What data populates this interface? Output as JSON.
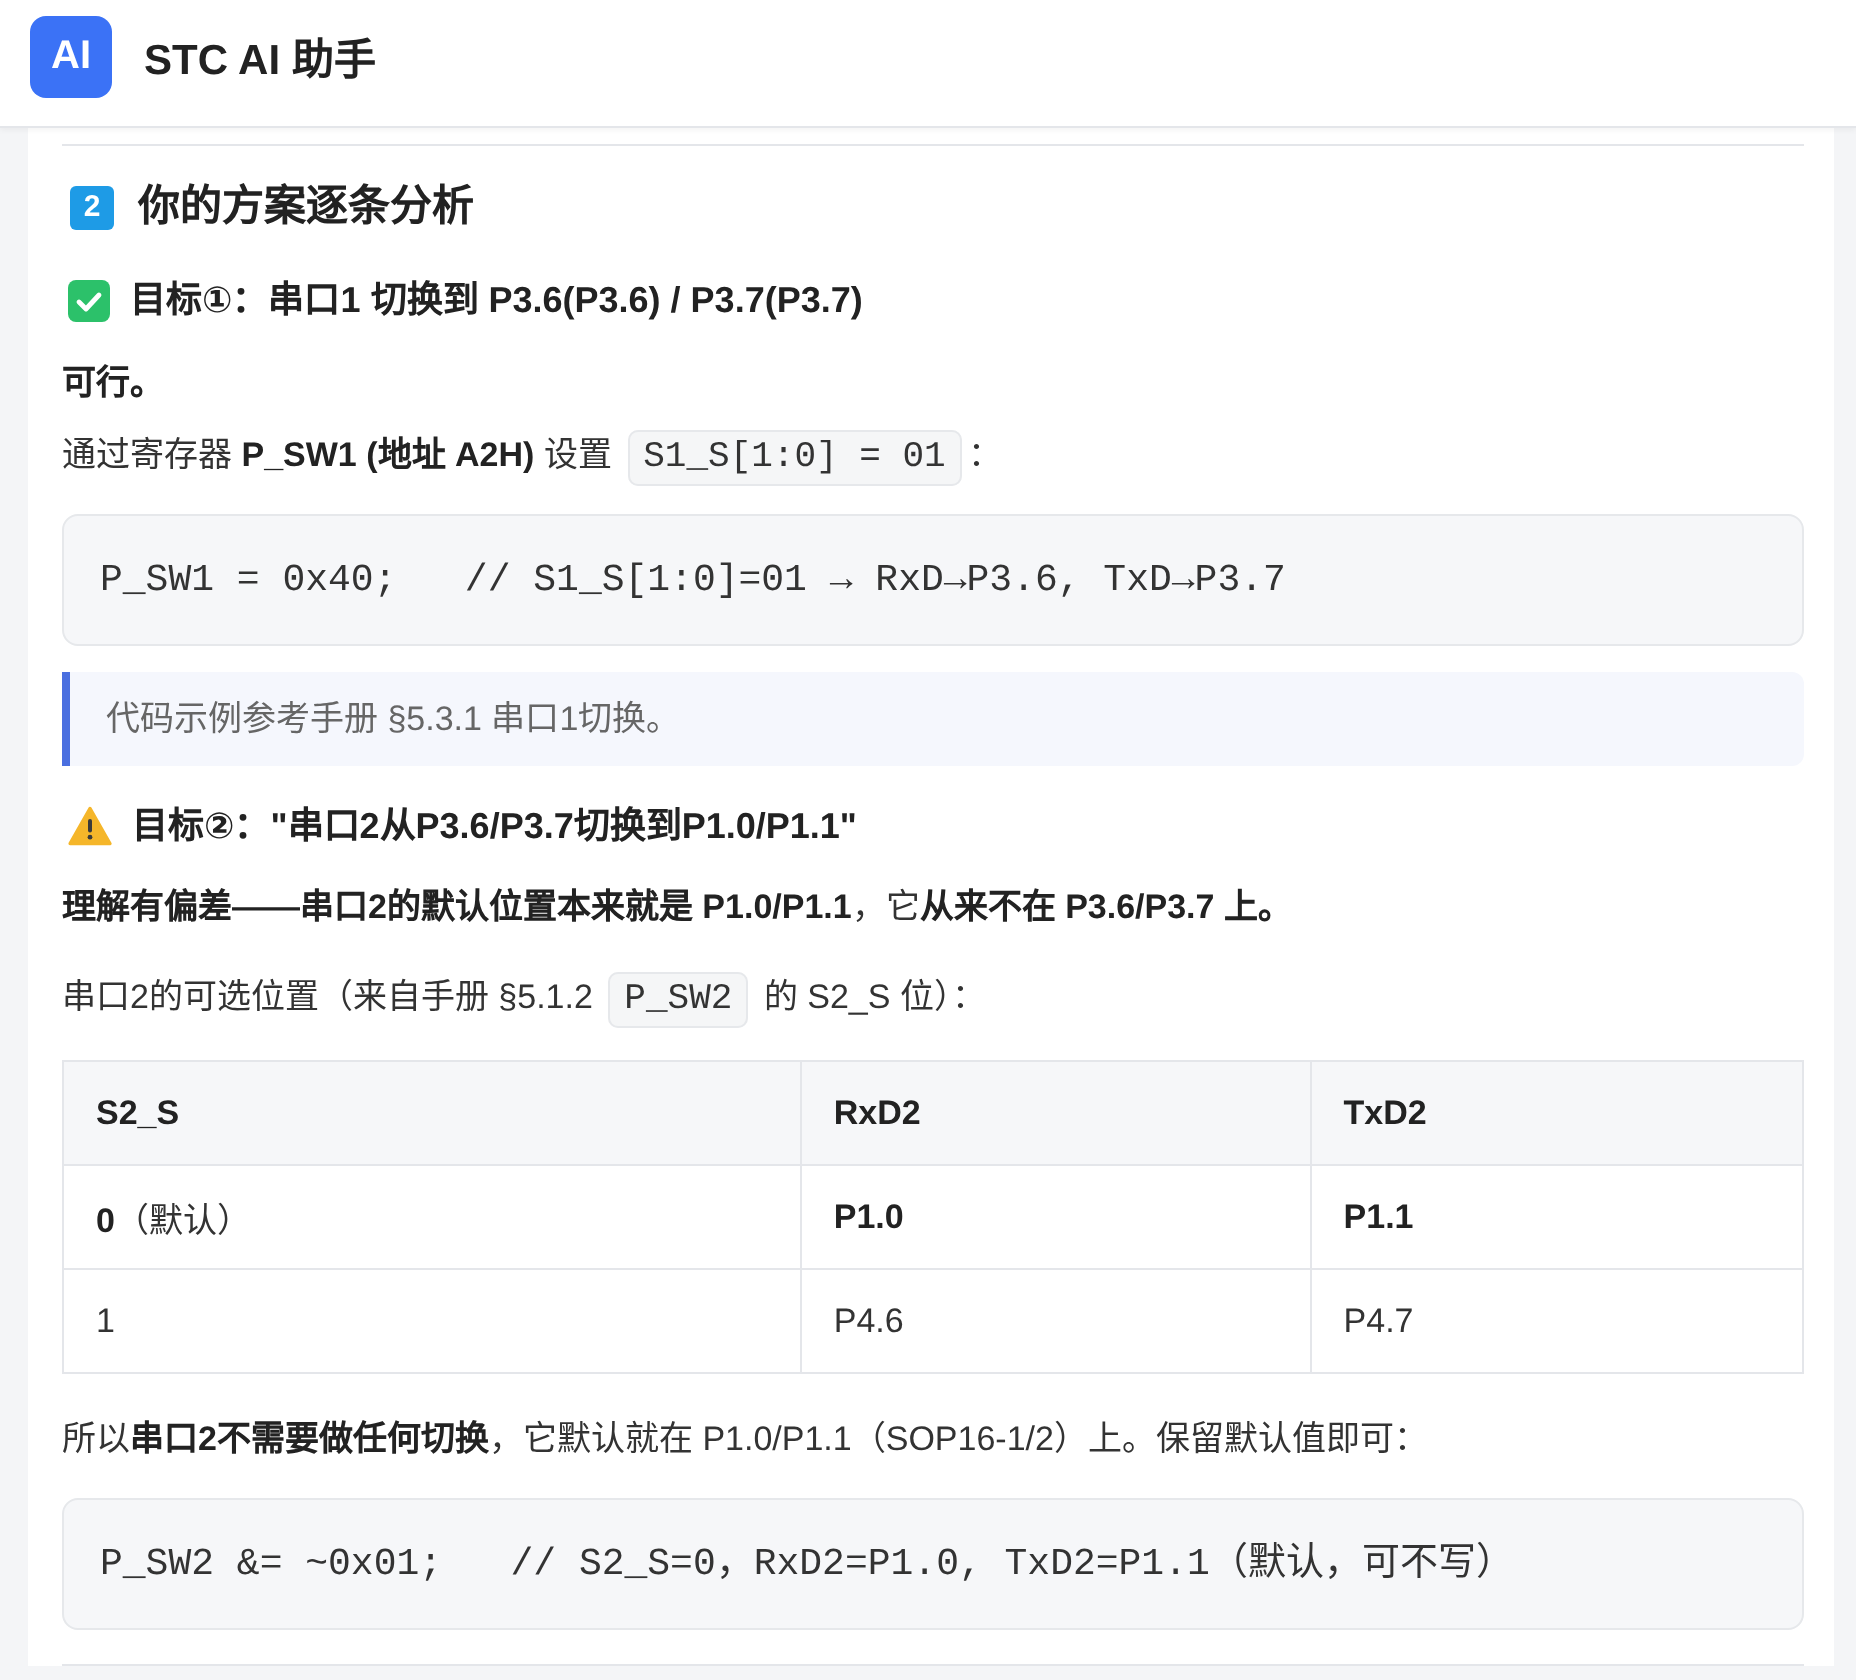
{
  "header": {
    "logo": "AI",
    "title": "STC AI 助手"
  },
  "blocks": [
    {
      "kind": "rule"
    },
    {
      "kind": "heading",
      "number": "2",
      "text": "你的方案逐条分析"
    },
    {
      "kind": "subheading",
      "icon": {
        "kind": "check"
      },
      "text": "目标①：串口1 切换到 P3.6(P3.6) / P3.7(P3.7)"
    },
    {
      "kind": "strong_paragraph",
      "text": "可行。"
    },
    {
      "kind": "paragraph",
      "parts": [
        {
          "kind": "text",
          "text": "通过寄存器 **P_SW1 (地址 A2H)** 设置 "
        },
        {
          "kind": "code",
          "text": "S1_S[1:0] = 01"
        },
        {
          "kind": "text",
          "text": "："
        }
      ]
    },
    {
      "kind": "code_block",
      "text": "P_SW1 = 0x40;   // S1_S[1:0]=01 → RxD→P3.6, TxD→P3.7"
    },
    {
      "kind": "quote",
      "text": "代码示例参考手册 §5.3.1 串口1切换。"
    },
    {
      "kind": "subheading",
      "icon": {
        "kind": "warning"
      },
      "text": "目标②：\"串口2从P3.6/P3.7切换到P1.0/P1.1\""
    },
    {
      "kind": "paragraph",
      "parts": [
        {
          "kind": "text",
          "text": "**理解有偏差——串口2的默认位置本来就是 P1.0/P1.1**，它**从来不在 P3.6/P3.7 上。**"
        }
      ]
    },
    {
      "kind": "paragraph",
      "parts": [
        {
          "kind": "text",
          "text": "串口2的可选位置（来自手册 §5.1.2 "
        },
        {
          "kind": "code",
          "text": "P_SW2"
        },
        {
          "kind": "text",
          "text": " 的 S2_S 位）："
        }
      ]
    },
    {
      "kind": "table",
      "columns": [
        "S2_S",
        "RxD2",
        "TxD2"
      ],
      "rows": [
        [
          "**0**（默认）",
          "**P1.0**",
          "**P1.1**"
        ],
        [
          "1",
          "P4.6",
          "P4.7"
        ]
      ]
    },
    {
      "kind": "paragraph",
      "parts": [
        {
          "kind": "text",
          "text": "所以**串口2不需要做任何切换**，它默认就在 P1.0/P1.1（SOP16-1/2）上。保留默认值即可："
        }
      ]
    },
    {
      "kind": "code_block",
      "text": "P_SW2 &= ~0x01;   // S2_S=0，RxD2=P1.0, TxD2=P1.1（默认，可不写）"
    },
    {
      "kind": "rule"
    }
  ]
}
